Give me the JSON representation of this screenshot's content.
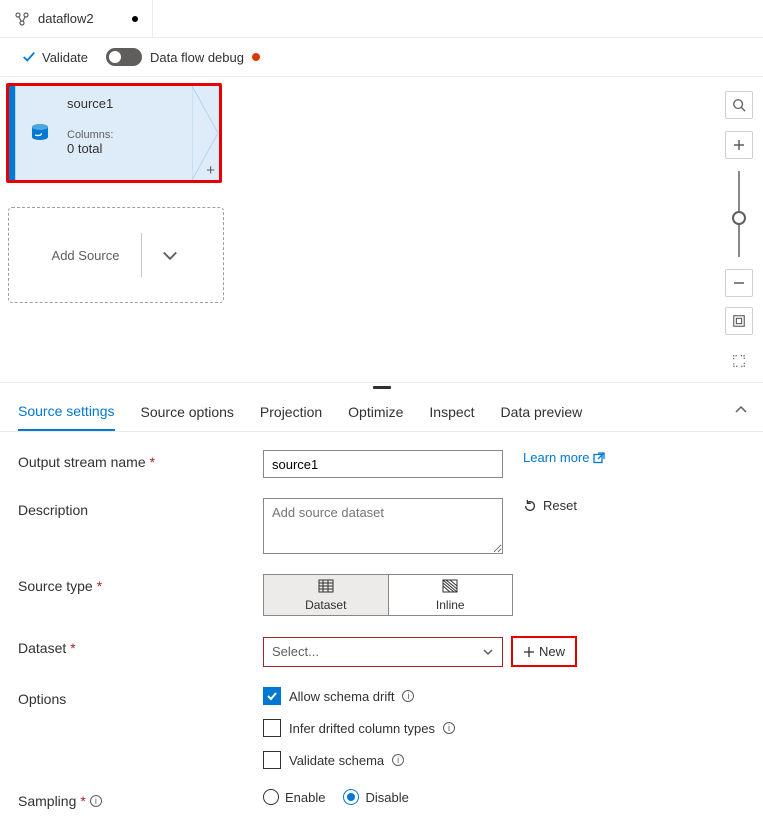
{
  "tab": {
    "title": "dataflow2"
  },
  "toolbar": {
    "validate_label": "Validate",
    "debug_label": "Data flow debug"
  },
  "canvas": {
    "source_node": {
      "title": "source1",
      "columns_label": "Columns:",
      "columns_count": "0 total"
    },
    "add_source_label": "Add Source"
  },
  "panel_tabs": [
    "Source settings",
    "Source options",
    "Projection",
    "Optimize",
    "Inspect",
    "Data preview"
  ],
  "form": {
    "output_stream_label": "Output stream name",
    "output_stream_value": "source1",
    "learn_more": "Learn more",
    "description_label": "Description",
    "description_placeholder": "Add source dataset",
    "reset_label": "Reset",
    "source_type_label": "Source type",
    "source_type_options": {
      "dataset": "Dataset",
      "inline": "Inline"
    },
    "dataset_label": "Dataset",
    "dataset_placeholder": "Select...",
    "new_label": "New",
    "options_label": "Options",
    "opt_allow_drift": "Allow schema drift",
    "opt_infer": "Infer drifted column types",
    "opt_validate": "Validate schema",
    "sampling_label": "Sampling",
    "sampling_enable": "Enable",
    "sampling_disable": "Disable"
  }
}
